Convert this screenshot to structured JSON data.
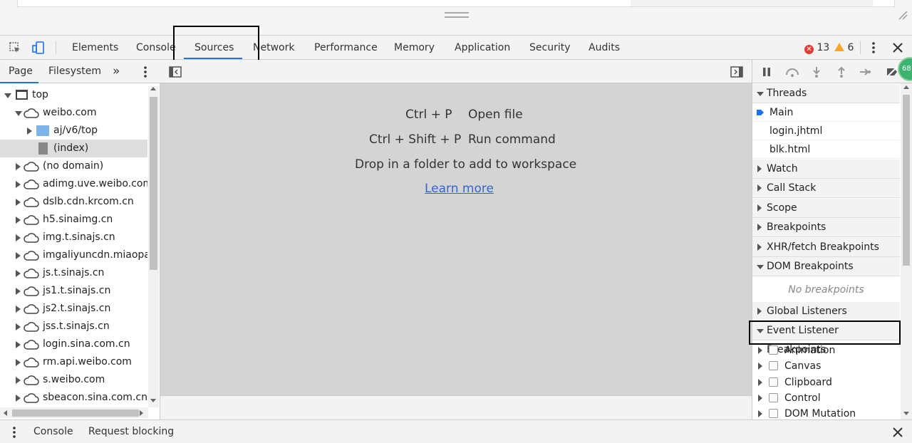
{
  "toolbar": {
    "tabs": [
      "Elements",
      "Console",
      "Sources",
      "Network",
      "Performance",
      "Memory",
      "Application",
      "Security",
      "Audits"
    ],
    "active_tab": "Sources",
    "error_count": "13",
    "warning_count": "6"
  },
  "navigator": {
    "tabs": [
      "Page",
      "Filesystem"
    ],
    "tree": {
      "top": "top",
      "weibo": "weibo.com",
      "folder": "aj/v6/top",
      "index": "(index)",
      "domains": [
        "(no domain)",
        "adimg.uve.weibo.com",
        "dslb.cdn.krcom.cn",
        "h5.sinaimg.cn",
        "img.t.sinajs.cn",
        "imgaliyuncdn.miaopai.",
        "js.t.sinajs.cn",
        "js1.t.sinajs.cn",
        "js2.t.sinajs.cn",
        "jss.t.sinajs.cn",
        "login.sina.com.cn",
        "rm.api.weibo.com",
        "s.weibo.com",
        "sbeacon.sina.com.cn"
      ]
    }
  },
  "editor": {
    "shortcut1_keys": "Ctrl + P",
    "shortcut1_action": "Open file",
    "shortcut2_keys": "Ctrl + Shift + P",
    "shortcut2_action": "Run command",
    "drop_hint": "Drop in a folder to add to workspace",
    "learn_more": "Learn more"
  },
  "debugger": {
    "threads_label": "Threads",
    "threads": [
      "Main",
      "login.jhtml",
      "blk.html"
    ],
    "watch": "Watch",
    "call_stack": "Call Stack",
    "scope": "Scope",
    "breakpoints": "Breakpoints",
    "xhr_breakpoints": "XHR/fetch Breakpoints",
    "dom_breakpoints": "DOM Breakpoints",
    "no_breakpoints": "No breakpoints",
    "global_listeners": "Global Listeners",
    "event_listener_breakpoints": "Event Listener Breakpoints",
    "event_categories": [
      "Animation",
      "Canvas",
      "Clipboard",
      "Control",
      "DOM Mutation"
    ],
    "badge": "68"
  },
  "drawer": {
    "tabs": [
      "Console",
      "Request blocking"
    ]
  },
  "colors": {
    "accent": "#1a73e8",
    "error": "#e53935",
    "warning": "#f9a825",
    "link": "#3366cc"
  }
}
